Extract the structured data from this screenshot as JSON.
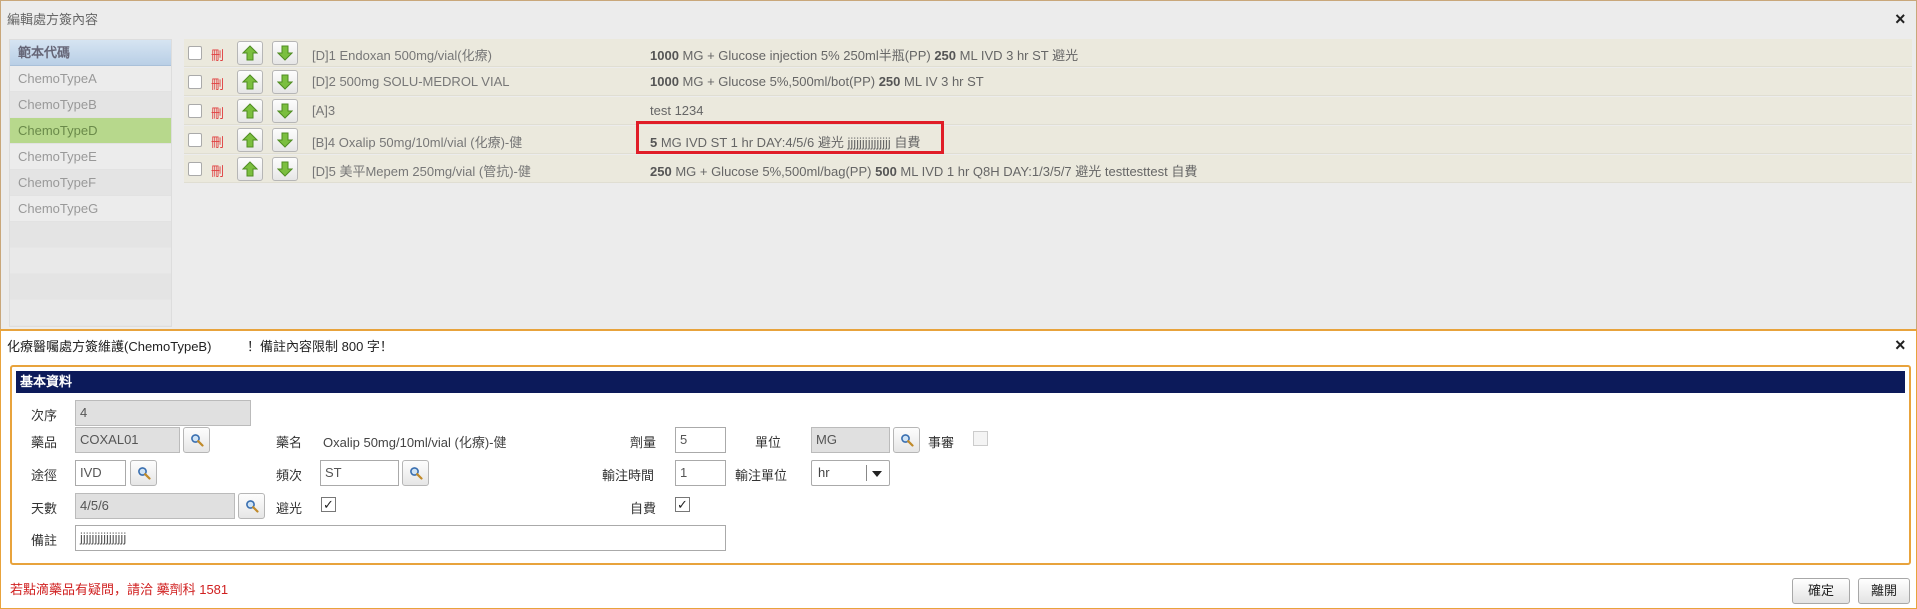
{
  "top_window": {
    "title": "編輯處方簽內容",
    "close_label": "×"
  },
  "sidebar": {
    "header": "範本代碼",
    "items": [
      {
        "label": "ChemoTypeA"
      },
      {
        "label": "ChemoTypeB"
      },
      {
        "label": "ChemoTypeD",
        "active": true
      },
      {
        "label": "ChemoTypeE"
      },
      {
        "label": "ChemoTypeF"
      },
      {
        "label": "ChemoTypeG"
      }
    ]
  },
  "rows": [
    {
      "delete_label": "刪",
      "name": "[D]1 Endoxan 500mg/vial(化療)",
      "dose": "1000",
      "detail_a": " MG  + Glucose injection 5% 250ml半瓶(PP) ",
      "vol": "250",
      "detail_b": " ML IVD 3 hr ST 避光"
    },
    {
      "delete_label": "刪",
      "name": "[D]2 500mg SOLU-MEDROL VIAL",
      "dose": "1000",
      "detail_a": " MG  + Glucose 5%,500ml/bot(PP) ",
      "vol": "250",
      "detail_b": " ML IV 3 hr ST"
    },
    {
      "delete_label": "刪",
      "name": "[A]3",
      "dose": "",
      "detail_a": "test 1234",
      "vol": "",
      "detail_b": ""
    },
    {
      "delete_label": "刪",
      "name": "[B]4 Oxalip 50mg/10ml/vial (化療)-健",
      "dose": "5",
      "detail_a": " MG IVD ST 1 hr DAY:4/5/6 避光 jjjjjjjjjjjjjjj 自費",
      "vol": "",
      "detail_b": ""
    },
    {
      "delete_label": "刪",
      "name": "[D]5 美平Mepem 250mg/vial (管抗)-健",
      "dose": "250",
      "detail_a": " MG  + Glucose 5%,500ml/bag(PP) ",
      "vol": "500",
      "detail_b": " ML IVD 1 hr Q8H DAY:1/3/5/7 避光 testtesttest 自費"
    }
  ],
  "dialog": {
    "title": "化療醫囑處方簽維護(ChemoTypeB)",
    "note": "！備註內容限制 800 字！",
    "close_label": "×",
    "section_title": "基本資料",
    "fields": {
      "seq_label": "次序",
      "seq_value": "4",
      "drug_label": "藥品",
      "drug_value": "COXAL01",
      "drug_name_label": "藥名",
      "drug_name_value": "Oxalip 50mg/10ml/vial (化療)-健",
      "dose_label": "劑量",
      "dose_value": "5",
      "unit_label": "單位",
      "unit_value": "MG",
      "review_label": "事審",
      "route_label": "途徑",
      "route_value": "IVD",
      "freq_label": "頻次",
      "freq_value": "ST",
      "infuse_time_label": "輸注時間",
      "infuse_time_value": "1",
      "infuse_unit_label": "輸注單位",
      "infuse_unit_value": "hr",
      "days_label": "天數",
      "days_value": "4/5/6",
      "light_label": "避光",
      "light_checked": "✓",
      "selfpay_label": "自費",
      "selfpay_checked": "✓",
      "remark_label": "備註",
      "remark_value": "jjjjjjjjjjjjjjjj"
    },
    "warning": "若點滴藥品有疑問，請洽 藥劑科 1581",
    "confirm_label": "確定",
    "leave_label": "離開"
  }
}
